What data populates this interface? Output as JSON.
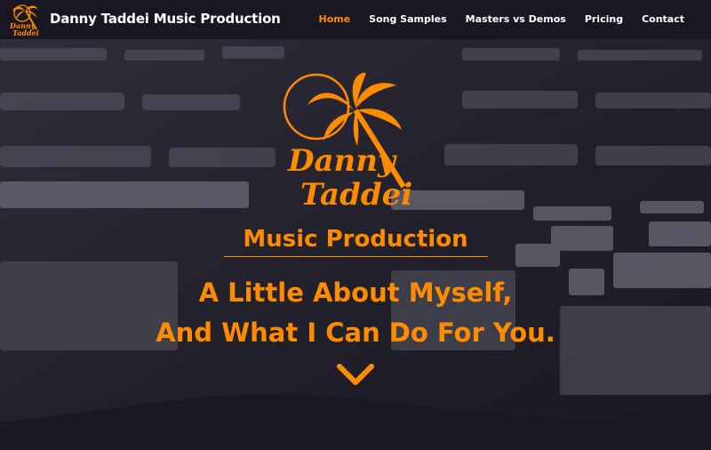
{
  "nav": {
    "brand": "Danny Taddei Music Production",
    "links": [
      {
        "label": "Home",
        "active": true
      },
      {
        "label": "Song Samples",
        "active": false
      },
      {
        "label": "Masters vs Demos",
        "active": false
      },
      {
        "label": "Pricing",
        "active": false
      },
      {
        "label": "Contact",
        "active": false
      }
    ],
    "logo_icon": "palm-tree-logo-icon"
  },
  "hero": {
    "logo_text_line1": "Danny",
    "logo_text_line2": "Taddei",
    "subtitle": "Music Production",
    "headline_line1": "A Little About Myself,",
    "headline_line2": "And What I Can Do For You.",
    "scroll_icon": "chevron-down-icon"
  },
  "colors": {
    "accent": "#ff8c00",
    "nav_bg": "#191822",
    "text": "#ffffff"
  }
}
